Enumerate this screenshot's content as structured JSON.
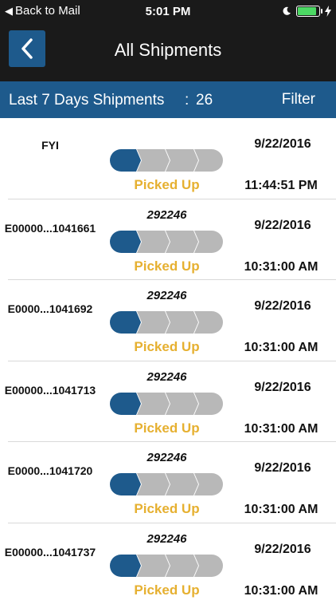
{
  "status_bar": {
    "back_label": "Back to Mail",
    "time": "5:01 PM",
    "battery_level": 0.9,
    "battery_color": "#4cd964",
    "icons": [
      "moon-icon",
      "battery-icon",
      "charging-bolt-icon"
    ]
  },
  "nav": {
    "title": "All Shipments",
    "back_icon": "chevron-left-icon"
  },
  "summary": {
    "label": "Last 7 Days Shipments",
    "separator": ":",
    "count": "26",
    "filter_label": "Filter"
  },
  "colors": {
    "accent": "#1e5a8c",
    "status_text": "#e6b030",
    "tracker_inactive": "#b8b8b8",
    "header_bg": "#1a1a1a"
  },
  "shipments": [
    {
      "ref": "FYI",
      "pro": "",
      "status": "Picked Up",
      "date": "9/22/2016",
      "time": "11:44:51 PM",
      "stage": 1
    },
    {
      "ref": "E00000...1041661",
      "pro": "292246",
      "status": "Picked Up",
      "date": "9/22/2016",
      "time": "10:31:00 AM",
      "stage": 1
    },
    {
      "ref": "E0000...1041692",
      "pro": "292246",
      "status": "Picked Up",
      "date": "9/22/2016",
      "time": "10:31:00 AM",
      "stage": 1
    },
    {
      "ref": "E00000...1041713",
      "pro": "292246",
      "status": "Picked Up",
      "date": "9/22/2016",
      "time": "10:31:00 AM",
      "stage": 1
    },
    {
      "ref": "E0000...1041720",
      "pro": "292246",
      "status": "Picked Up",
      "date": "9/22/2016",
      "time": "10:31:00 AM",
      "stage": 1
    },
    {
      "ref": "E00000...1041737",
      "pro": "292246",
      "status": "Picked Up",
      "date": "9/22/2016",
      "time": "10:31:00 AM",
      "stage": 1
    }
  ]
}
